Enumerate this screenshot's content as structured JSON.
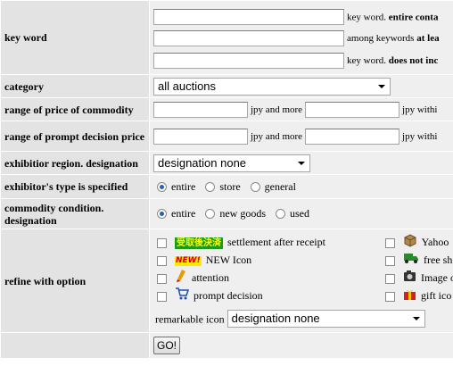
{
  "keyword": {
    "label": "key word",
    "rows": [
      {
        "value": "",
        "note_plain": "key word.",
        "note_bold": "entire conta"
      },
      {
        "value": "",
        "note_plain": "among keywords",
        "note_bold": "at lea"
      },
      {
        "value": "",
        "note_plain": "key word.",
        "note_bold": "does not inc"
      }
    ]
  },
  "category": {
    "label": "category",
    "selected": "all auctions"
  },
  "price": {
    "label": "range of price of commodity",
    "min": "",
    "max": "",
    "unit_min": "jpy and more",
    "unit_max": "jpy withi"
  },
  "prompt_price": {
    "label": "range of prompt decision price",
    "min": "",
    "max": "",
    "unit_min": "jpy and more",
    "unit_max": "jpy withi"
  },
  "region": {
    "label": "exhibitior region. designation",
    "selected": "designation none"
  },
  "exhibitor_type": {
    "label": "exhibitor's type is specified",
    "options": [
      "entire",
      "store",
      "general"
    ],
    "checked": 0
  },
  "condition": {
    "label": "commodity condition. designation",
    "options": [
      "entire",
      "new goods",
      "used"
    ],
    "checked": 0
  },
  "refine": {
    "label": "refine with option",
    "left": [
      {
        "icon": "settlement-icon",
        "badge": "受取後決済",
        "label": "settlement after receipt"
      },
      {
        "icon": "new-icon",
        "badge": "NEW!",
        "label": "NEW Icon"
      },
      {
        "icon": "attention-icon",
        "label": "attention"
      },
      {
        "icon": "cart-icon",
        "label": "prompt decision"
      }
    ],
    "right": [
      {
        "icon": "box-icon",
        "label": "Yahoo"
      },
      {
        "icon": "truck-icon",
        "label": "free sh"
      },
      {
        "icon": "camera-icon",
        "label": "Image o"
      },
      {
        "icon": "gift-icon",
        "label": "gift ico"
      }
    ],
    "remarkable_label": "remarkable icon",
    "remarkable_selected": "designation none"
  },
  "submit_label": "GO!"
}
